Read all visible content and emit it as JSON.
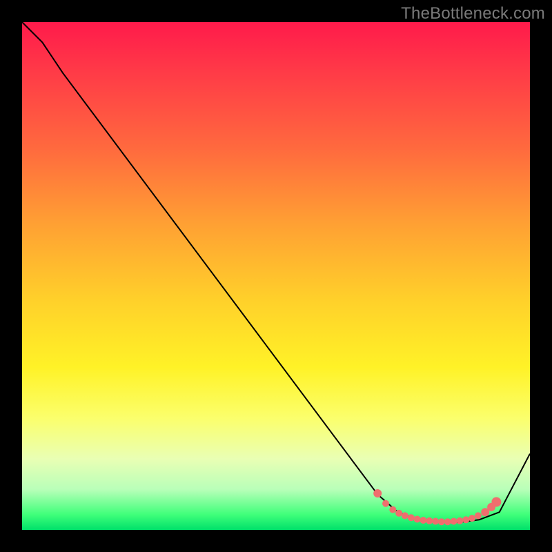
{
  "watermark": "TheBottleneck.com",
  "colors": {
    "frame": "#000000",
    "curve": "#000000",
    "dot": "#ef6e6e"
  },
  "chart_data": {
    "type": "line",
    "title": "",
    "xlabel": "",
    "ylabel": "",
    "xlim": [
      0,
      1
    ],
    "ylim": [
      0,
      1
    ],
    "series": [
      {
        "name": "curve",
        "x": [
          0.0,
          0.04,
          0.08,
          0.7,
          0.74,
          0.78,
          0.82,
          0.86,
          0.9,
          0.94,
          1.0
        ],
        "y": [
          1.0,
          0.96,
          0.9,
          0.07,
          0.035,
          0.02,
          0.015,
          0.015,
          0.02,
          0.035,
          0.15
        ]
      }
    ],
    "markers": {
      "name": "dots",
      "comment": "approximate dense cluster near bottom of valley; sizes vary",
      "points": [
        {
          "x": 0.7,
          "y": 0.072,
          "r": 6
        },
        {
          "x": 0.716,
          "y": 0.052,
          "r": 5
        },
        {
          "x": 0.73,
          "y": 0.04,
          "r": 5
        },
        {
          "x": 0.742,
          "y": 0.033,
          "r": 5
        },
        {
          "x": 0.754,
          "y": 0.028,
          "r": 5
        },
        {
          "x": 0.766,
          "y": 0.024,
          "r": 5
        },
        {
          "x": 0.778,
          "y": 0.021,
          "r": 5
        },
        {
          "x": 0.79,
          "y": 0.019,
          "r": 5
        },
        {
          "x": 0.802,
          "y": 0.018,
          "r": 5
        },
        {
          "x": 0.814,
          "y": 0.017,
          "r": 5
        },
        {
          "x": 0.826,
          "y": 0.016,
          "r": 5
        },
        {
          "x": 0.838,
          "y": 0.016,
          "r": 5
        },
        {
          "x": 0.85,
          "y": 0.017,
          "r": 5
        },
        {
          "x": 0.862,
          "y": 0.018,
          "r": 5
        },
        {
          "x": 0.874,
          "y": 0.02,
          "r": 5
        },
        {
          "x": 0.886,
          "y": 0.023,
          "r": 5
        },
        {
          "x": 0.898,
          "y": 0.028,
          "r": 5
        },
        {
          "x": 0.912,
          "y": 0.035,
          "r": 6
        },
        {
          "x": 0.924,
          "y": 0.045,
          "r": 6
        },
        {
          "x": 0.934,
          "y": 0.055,
          "r": 7
        }
      ]
    }
  }
}
